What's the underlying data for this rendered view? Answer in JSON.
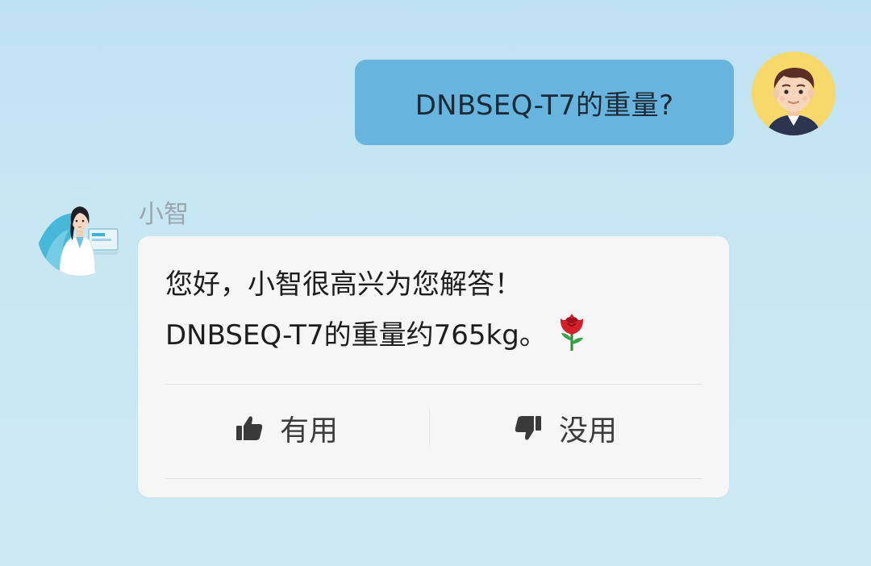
{
  "user_message": {
    "text": "DNBSEQ-T7的重量?",
    "avatar_icon": "man-avatar-icon"
  },
  "bot": {
    "name": "小智",
    "avatar_icon": "doctor-assistant-avatar-icon",
    "lines": [
      "您好，小智很高兴为您解答！",
      "DNBSEQ-T7的重量约765kg。"
    ],
    "emoji_icon": "rose-icon"
  },
  "feedback": {
    "useful_label": "有用",
    "useful_icon": "thumbs-up-icon",
    "useless_label": "没用",
    "useless_icon": "thumbs-down-icon"
  },
  "colors": {
    "background": "#c8e7f3",
    "user_bubble": "#67b5de",
    "bot_card": "#f6f6f6",
    "bot_name": "#9ba7ae"
  }
}
